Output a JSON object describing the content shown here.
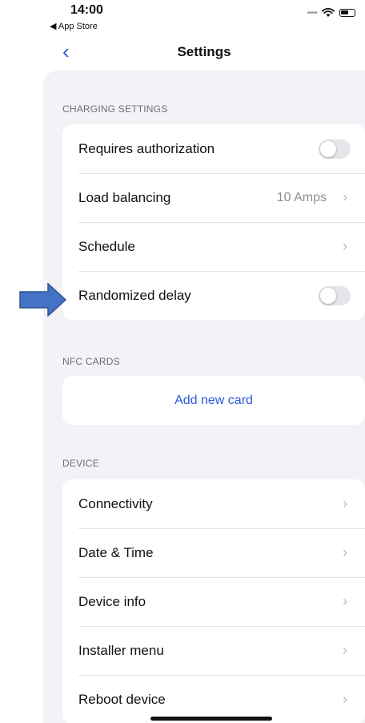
{
  "status_bar": {
    "time": "14:00",
    "back_app": "◀ App Store"
  },
  "nav": {
    "title": "Settings"
  },
  "sections": {
    "charging": {
      "header": "CHARGING SETTINGS",
      "rows": {
        "requires_authorization": {
          "label": "Requires authorization",
          "toggle_on": false
        },
        "load_balancing": {
          "label": "Load balancing",
          "value": "10 Amps"
        },
        "schedule": {
          "label": "Schedule"
        },
        "randomized_delay": {
          "label": "Randomized delay",
          "toggle_on": false
        }
      }
    },
    "nfc": {
      "header": "NFC CARDS",
      "add_card": "Add new card"
    },
    "device": {
      "header": "DEVICE",
      "rows": {
        "connectivity": {
          "label": "Connectivity"
        },
        "date_time": {
          "label": "Date & Time"
        },
        "device_info": {
          "label": "Device info"
        },
        "installer_menu": {
          "label": "Installer menu"
        },
        "reboot_device": {
          "label": "Reboot device"
        }
      }
    }
  },
  "colors": {
    "accent": "#2a5bd7",
    "sheet_background": "#f2f2f7",
    "annotation_arrow": "#4472c4"
  },
  "icons": {
    "back": "chevron-left-icon",
    "row_disclosure": "chevron-right-icon",
    "annotation": "arrow-right-icon"
  }
}
